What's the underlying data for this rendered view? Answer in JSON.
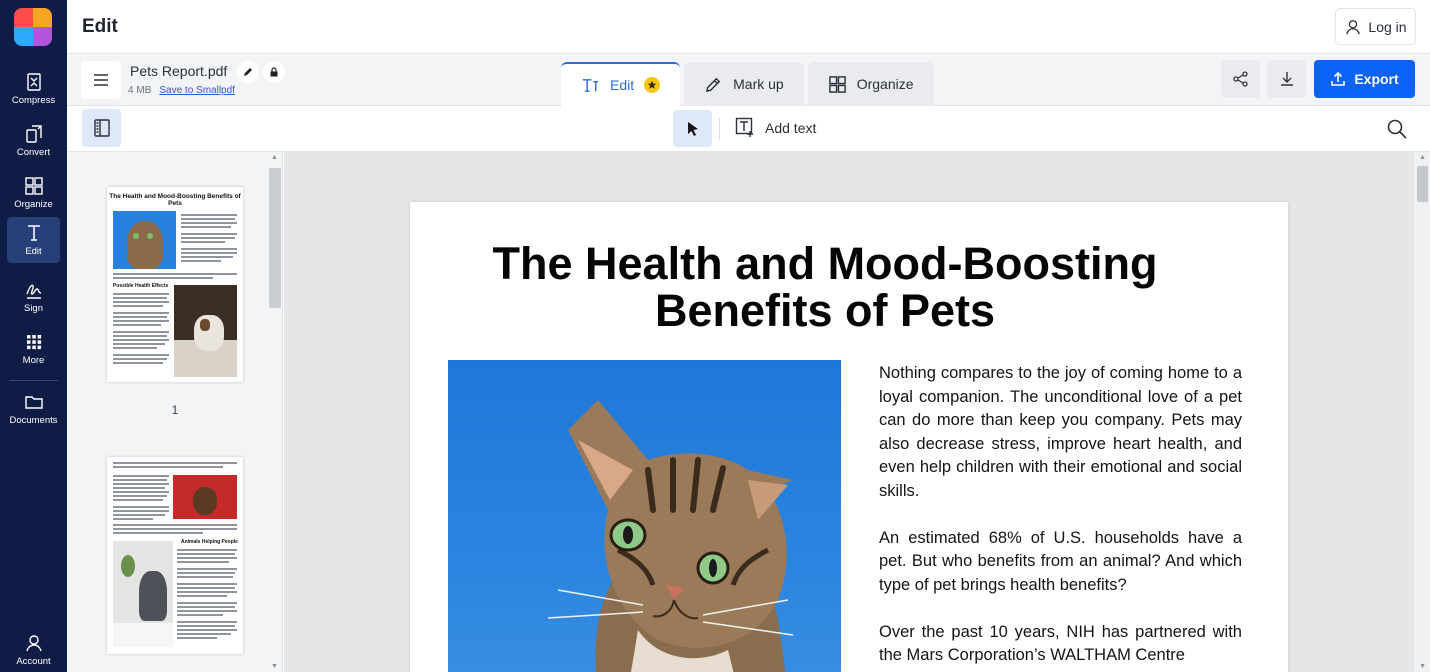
{
  "app": {
    "logo_colors": [
      "#ff4d4d",
      "#f5a623",
      "#2fa8ff",
      "#b455e0"
    ],
    "header_title": "Edit",
    "login_label": "Log in"
  },
  "rail": {
    "items": [
      {
        "label": "Compress",
        "icon": "compress-icon"
      },
      {
        "label": "Convert",
        "icon": "convert-icon"
      },
      {
        "label": "Organize",
        "icon": "organize-icon"
      },
      {
        "label": "Edit",
        "icon": "edit-text-icon"
      },
      {
        "label": "Sign",
        "icon": "sign-icon"
      },
      {
        "label": "More",
        "icon": "grid-dots-icon"
      },
      {
        "label": "Documents",
        "icon": "folder-icon"
      },
      {
        "label": "Account",
        "icon": "account-icon"
      }
    ]
  },
  "file": {
    "name": "Pets Report.pdf",
    "size": "4 MB",
    "save_link": "Save to Smallpdf"
  },
  "tabs": [
    {
      "label": "Edit",
      "icon": "edit-text-icon",
      "active": true
    },
    {
      "label": "Mark up",
      "icon": "pencil-icon",
      "active": false
    },
    {
      "label": "Organize",
      "icon": "organize-icon",
      "active": false
    }
  ],
  "actions": {
    "export_label": "Export"
  },
  "toolbar": {
    "add_text_label": "Add text"
  },
  "thumbnails": {
    "page1_title": "The Health and Mood-Boosting Benefits of Pets",
    "page1_subheading": "Possible Health Effects",
    "page2_subheading": "Animals Helping People",
    "page1_label": "1"
  },
  "document": {
    "title_line1": "The Health and Mood-Boosting",
    "title_line2": "Benefits of Pets",
    "paragraphs": [
      "Nothing compares to the joy of coming home to a loyal companion. The unconditional love of a pet can do more than keep you company. Pets may also decrease stress, improve heart health, and even help children with their emotional and social skills.",
      "An estimated 68% of U.S. households have a pet. But who benefits from an animal? And which type of pet brings health benefits?",
      "Over the past 10 years, NIH has partnered with the Mars Corporation’s WALTHAM Centre"
    ]
  },
  "colors": {
    "rail_bg": "#0f1d46",
    "accent": "#0a63f6",
    "active_tab": "#2b6be0"
  }
}
